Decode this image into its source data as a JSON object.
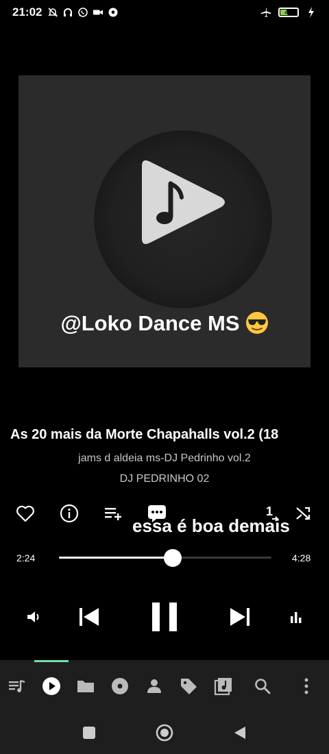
{
  "status_bar": {
    "time": "21:02",
    "battery_level": "47",
    "battery_fraction": 0.47,
    "icons_left": [
      "mute-icon",
      "headphones-icon",
      "whatsapp-icon",
      "video-icon",
      "soccer-icon"
    ],
    "icons_right": [
      "airplane-icon",
      "battery-icon",
      "charging-icon"
    ]
  },
  "artwork": {
    "overlay_text": "@Loko Dance MS"
  },
  "track": {
    "title": "As 20 mais da Morte Chapahalls vol.2 (18",
    "album": "jams d aldeia ms-DJ Pedrinho vol.2",
    "artist": "DJ PEDRINHO 02"
  },
  "actions": {
    "items": [
      "heart-icon",
      "info-icon",
      "playlist-add-icon",
      "comment-icon",
      "repeat-one-icon",
      "shuffle-icon"
    ],
    "comment_text": "essa é boa demais"
  },
  "playback": {
    "current_time": "2:24",
    "total_time": "4:28",
    "progress": 0.537
  },
  "transport": [
    "volume-icon",
    "previous-icon",
    "pause-icon",
    "next-icon",
    "equalizer-icon"
  ],
  "bottom_nav": {
    "items": [
      "queue-icon",
      "now-playing-icon",
      "folder-icon",
      "album-icon",
      "artist-icon",
      "tag-icon",
      "playlist-icon",
      "search-icon",
      "more-icon"
    ],
    "active": "now-playing-icon",
    "indicator_color": "#6ee0a8"
  },
  "system_nav": [
    "recent-apps-icon",
    "home-icon",
    "back-icon"
  ]
}
